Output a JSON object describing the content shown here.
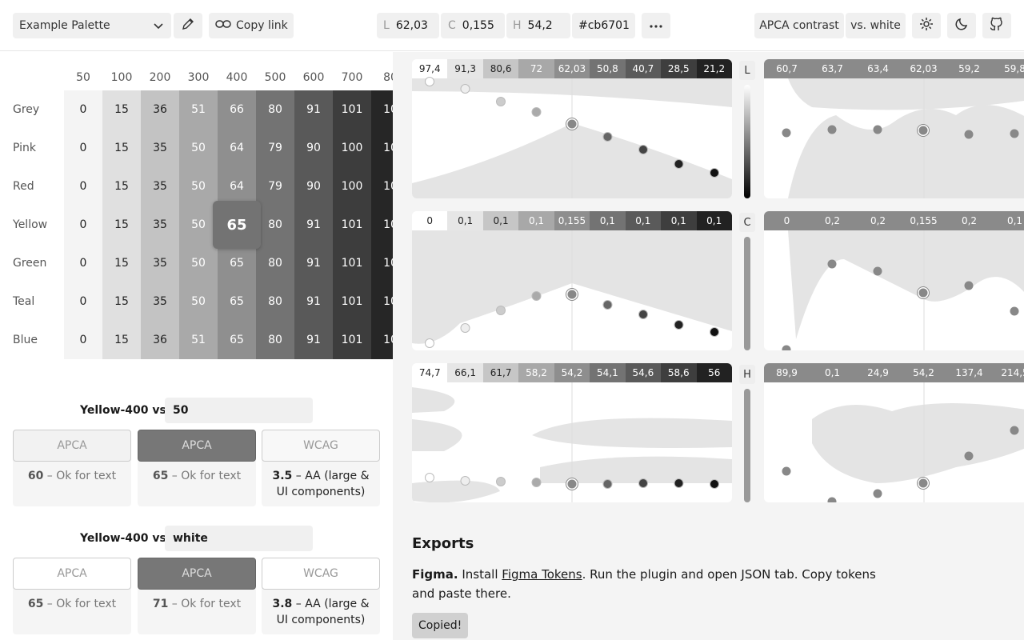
{
  "toolbar": {
    "palette_name": "Example Palette",
    "copy_link": "Copy link",
    "l_key": "L",
    "l_val": "62,03",
    "c_key": "C",
    "c_val": "0,155",
    "h_key": "H",
    "h_val": "54,2",
    "hex": "#cb6701",
    "contrast_mode": "APCA contrast",
    "vs": "vs. white"
  },
  "table": {
    "columns": [
      "50",
      "100",
      "200",
      "300",
      "400",
      "500",
      "600",
      "700",
      "80"
    ],
    "rows": [
      {
        "name": "Grey",
        "vals": [
          "0",
          "15",
          "36",
          "51",
          "66",
          "80",
          "91",
          "101",
          "10"
        ]
      },
      {
        "name": "Pink",
        "vals": [
          "0",
          "15",
          "35",
          "50",
          "64",
          "79",
          "90",
          "100",
          "10"
        ]
      },
      {
        "name": "Red",
        "vals": [
          "0",
          "15",
          "35",
          "50",
          "64",
          "79",
          "90",
          "100",
          "10"
        ]
      },
      {
        "name": "Yellow",
        "vals": [
          "0",
          "15",
          "35",
          "50",
          "65",
          "80",
          "91",
          "101",
          "10"
        ]
      },
      {
        "name": "Green",
        "vals": [
          "0",
          "15",
          "35",
          "50",
          "65",
          "80",
          "91",
          "101",
          "10"
        ]
      },
      {
        "name": "Teal",
        "vals": [
          "0",
          "15",
          "35",
          "50",
          "65",
          "80",
          "91",
          "101",
          "10"
        ]
      },
      {
        "name": "Blue",
        "vals": [
          "0",
          "15",
          "36",
          "51",
          "65",
          "80",
          "91",
          "101",
          "10"
        ]
      }
    ],
    "selected": "65"
  },
  "comparisons": [
    {
      "label": "Yellow-400 vs.",
      "input": "50",
      "cards": [
        {
          "head": "APCA",
          "score": "60",
          "text": " – Ok for text"
        },
        {
          "head": "APCA",
          "score": "65",
          "text": " – Ok for text"
        },
        {
          "head": "WCAG",
          "score": "3.5",
          "text": " – AA (large & UI components)"
        }
      ]
    },
    {
      "label": "Yellow-400 vs.",
      "input": "white",
      "cards": [
        {
          "head": "APCA",
          "score": "65",
          "text": " – Ok for text"
        },
        {
          "head": "APCA",
          "score": "71",
          "text": " – Ok for text"
        },
        {
          "head": "WCAG",
          "score": "3.8",
          "text": " – AA (large & UI components)"
        }
      ]
    }
  ],
  "charts": {
    "L": {
      "axis": "L",
      "left": [
        "97,4",
        "91,3",
        "80,6",
        "72",
        "62,03",
        "50,8",
        "40,7",
        "28,5",
        "21,2"
      ],
      "right": [
        "60,7",
        "63,7",
        "63,4",
        "62,03",
        "59,2",
        "59,8"
      ]
    },
    "C": {
      "axis": "C",
      "left": [
        "0",
        "0,1",
        "0,1",
        "0,1",
        "0,155",
        "0,1",
        "0,1",
        "0,1",
        "0,1"
      ],
      "right": [
        "0",
        "0,2",
        "0,2",
        "0,155",
        "0,2",
        "0,1"
      ]
    },
    "H": {
      "axis": "H",
      "left": [
        "74,7",
        "66,1",
        "61,7",
        "58,2",
        "54,2",
        "54,1",
        "54,6",
        "58,6",
        "56"
      ],
      "right": [
        "89,9",
        "0,1",
        "24,9",
        "54,2",
        "137,4",
        "214,5"
      ]
    }
  },
  "exports": {
    "title": "Exports",
    "figma_label": "Figma.",
    "install": "Install",
    "link": "Figma Tokens",
    "rest": ". Run the plugin and open JSON tab. Copy tokens and paste there.",
    "copied": "Copied!"
  }
}
